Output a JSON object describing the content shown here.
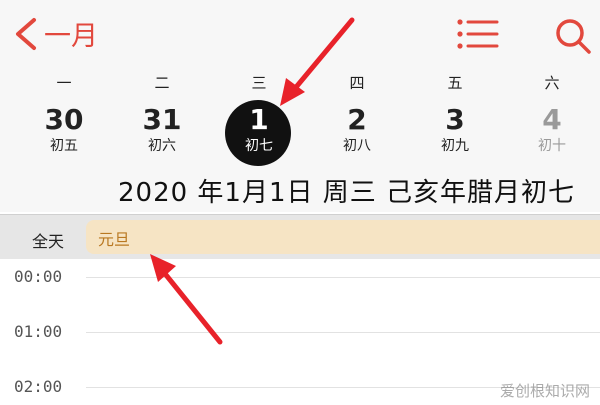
{
  "nav": {
    "back_label": "一月"
  },
  "week": {
    "weekdays": [
      "一",
      "二",
      "三",
      "四",
      "五",
      "六"
    ],
    "dates": [
      {
        "num": "30",
        "lunar": "初五"
      },
      {
        "num": "31",
        "lunar": "初六"
      },
      {
        "num": "1",
        "lunar": "初七"
      },
      {
        "num": "2",
        "lunar": "初八"
      },
      {
        "num": "3",
        "lunar": "初九"
      },
      {
        "num": "4",
        "lunar": "初十"
      }
    ],
    "full_date": "2020 年1月1日  周三   己亥年腊月初七"
  },
  "allday": {
    "label": "全天",
    "event_title": "元旦"
  },
  "timeline": {
    "hours": [
      "00:00",
      "01:00",
      "02:00"
    ]
  },
  "colors": {
    "accent": "#e2483d",
    "event_bg": "#f6e4c4",
    "event_text": "#b97821"
  },
  "watermark": "爱创根知识网"
}
